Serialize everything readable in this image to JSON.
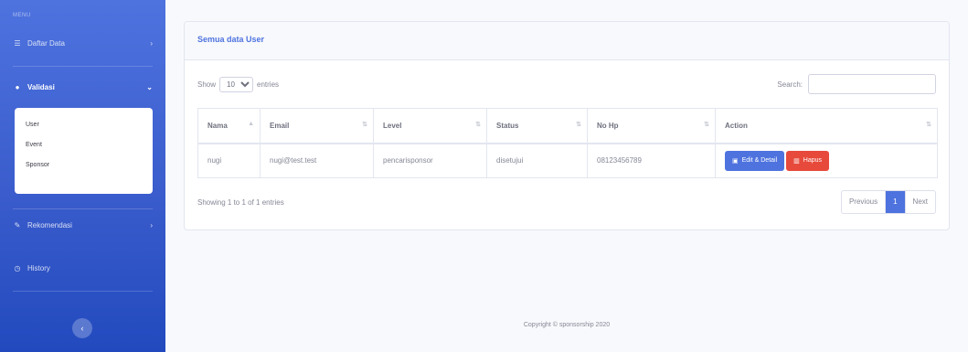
{
  "sidebar": {
    "heading": "MENU",
    "items": [
      {
        "label": "Daftar Data",
        "icon": "list-icon"
      },
      {
        "label": "Validasi",
        "icon": "circle-icon"
      },
      {
        "label": "Rekomendasi",
        "icon": "pen-icon"
      },
      {
        "label": "History",
        "icon": "clock-icon"
      }
    ],
    "submenu": [
      "User",
      "Event",
      "Sponsor"
    ],
    "toggle_glyph": "‹"
  },
  "card": {
    "title": "Semua data User"
  },
  "datatable": {
    "show_label": "Show",
    "entries_value": "10",
    "entries_label": "entries",
    "search_label": "Search:",
    "search_value": "",
    "columns": [
      "Nama",
      "Email",
      "Level",
      "Status",
      "No Hp",
      "Action"
    ],
    "rows": [
      {
        "nama": "nugi",
        "email": "nugi@test.test",
        "level": "pencarisponsor",
        "status": "disetujui",
        "hp": "08123456789"
      }
    ],
    "edit_label": "Edit & Detail",
    "delete_label": "Hapus",
    "info": "Showing 1 to 1 of 1 entries",
    "prev_label": "Previous",
    "page": "1",
    "next_label": "Next"
  },
  "footer": {
    "text": "Copyright © sponsorship 2020"
  },
  "colors": {
    "primary": "#4e73df",
    "danger": "#e74a3b",
    "sidebar_dark": "#224abe"
  }
}
